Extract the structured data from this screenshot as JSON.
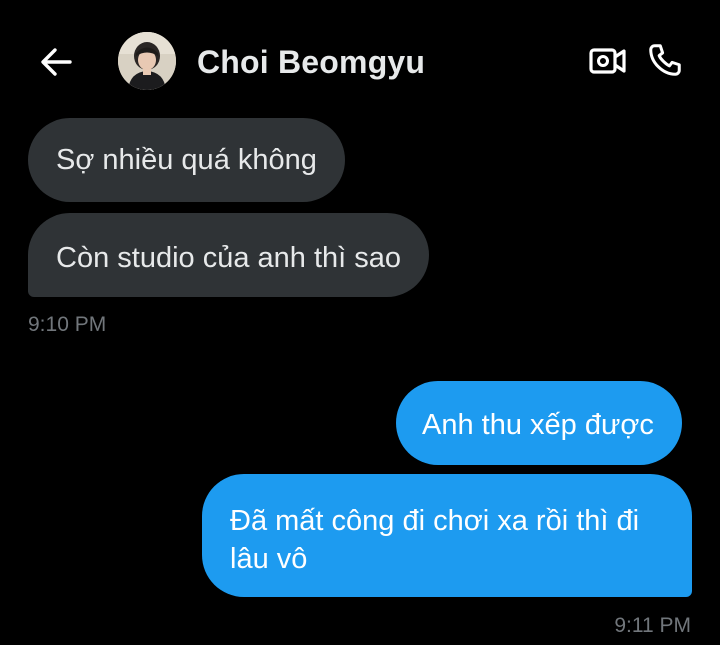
{
  "conversation": {
    "contact_name": "Choi Beomgyu"
  },
  "header": {
    "back_icon": "arrow-left-icon",
    "video_icon": "video-call-icon",
    "call_icon": "phone-call-icon"
  },
  "messages": [
    {
      "direction": "incoming",
      "text": "Sợ nhiều quá không"
    },
    {
      "direction": "incoming",
      "text": "Còn studio của anh thì sao"
    },
    {
      "direction": "outgoing",
      "text": "Anh thu xếp được"
    },
    {
      "direction": "outgoing",
      "text": "Đã mất công đi chơi xa rồi thì đi lâu vô"
    }
  ],
  "timestamps": {
    "incoming_group": "9:10 PM",
    "outgoing_group": "9:11 PM"
  },
  "colors": {
    "background": "#000000",
    "incoming_bubble": "#2f3336",
    "outgoing_bubble": "#1d9bf0",
    "primary_text": "#e7e9ea",
    "timestamp_text": "#71767b"
  }
}
